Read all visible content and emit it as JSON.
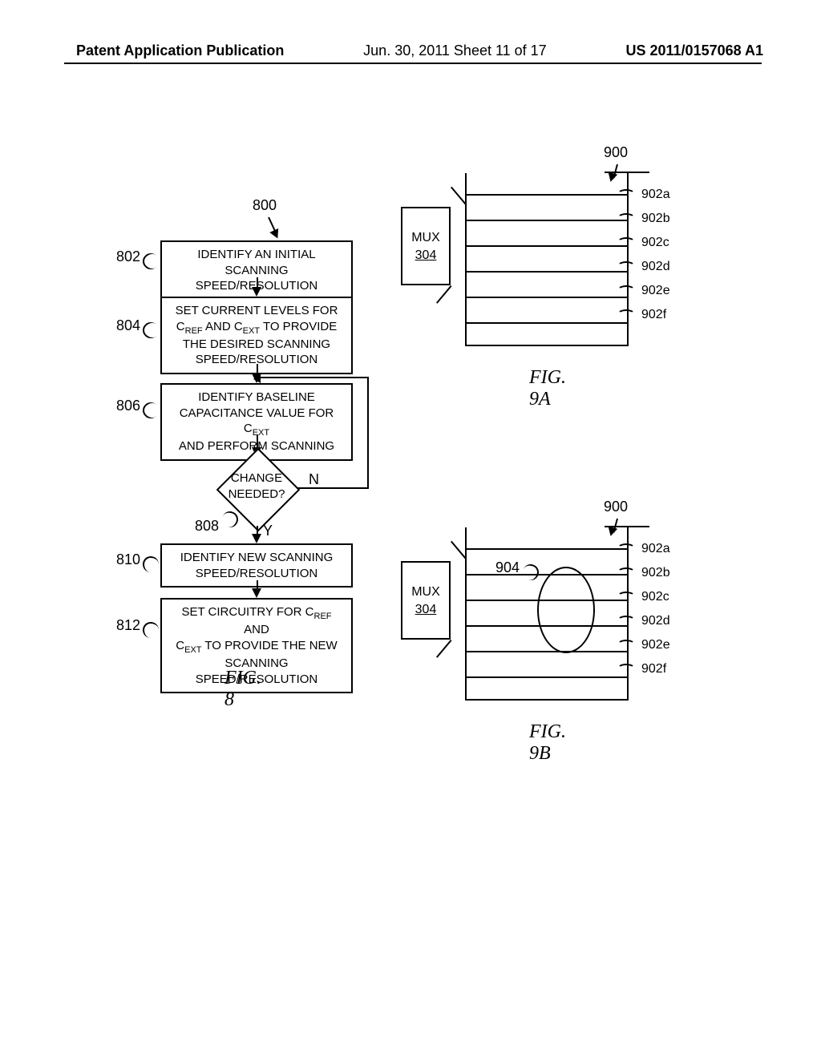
{
  "header": {
    "left": "Patent Application Publication",
    "center": "Jun. 30, 2011  Sheet 11 of 17",
    "right": "US 2011/0157068 A1"
  },
  "fig8": {
    "caption": "FIG. 8",
    "label_800": "800",
    "steps": {
      "s802": {
        "ref": "802",
        "text_l1": "IDENTIFY AN INITIAL SCANNING",
        "text_l2": "SPEED/RESOLUTION"
      },
      "s804": {
        "ref": "804",
        "text_l1": "SET CURRENT LEVELS FOR",
        "text_l2a": "C",
        "text_l2a_sub": "REF",
        "text_l2b": " AND C",
        "text_l2b_sub": "EXT",
        "text_l2c": " TO PROVIDE",
        "text_l3": "THE DESIRED SCANNING",
        "text_l4": "SPEED/RESOLUTION"
      },
      "s806": {
        "ref": "806",
        "text_l1": "IDENTIFY BASELINE",
        "text_l2a": "CAPACITANCE VALUE FOR C",
        "text_l2a_sub": "EXT",
        "text_l3": "AND PERFORM SCANNING"
      },
      "s808": {
        "ref": "808",
        "text_l1": "CHANGE",
        "text_l2": "NEEDED?",
        "yes": "Y",
        "no": "N"
      },
      "s810": {
        "ref": "810",
        "text_l1": "IDENTIFY NEW SCANNING",
        "text_l2": "SPEED/RESOLUTION"
      },
      "s812": {
        "ref": "812",
        "text_l1a": "SET CIRCUITRY FOR C",
        "text_l1a_sub": "REF",
        "text_l1b": " AND",
        "text_l2a": "C",
        "text_l2a_sub": "EXT",
        "text_l2b": " TO PROVIDE THE NEW",
        "text_l3": "SCANNING SPEED/RESOLUTION"
      }
    }
  },
  "fig9a": {
    "caption": "FIG. 9A",
    "label_900": "900",
    "mux_label": "MUX",
    "mux_num": "304",
    "rows": [
      "902a",
      "902b",
      "902c",
      "902d",
      "902e",
      "902f"
    ]
  },
  "fig9b": {
    "caption": "FIG. 9B",
    "label_900": "900",
    "label_904": "904",
    "mux_label": "MUX",
    "mux_num": "304",
    "rows": [
      "902a",
      "902b",
      "902c",
      "902d",
      "902e",
      "902f"
    ]
  }
}
